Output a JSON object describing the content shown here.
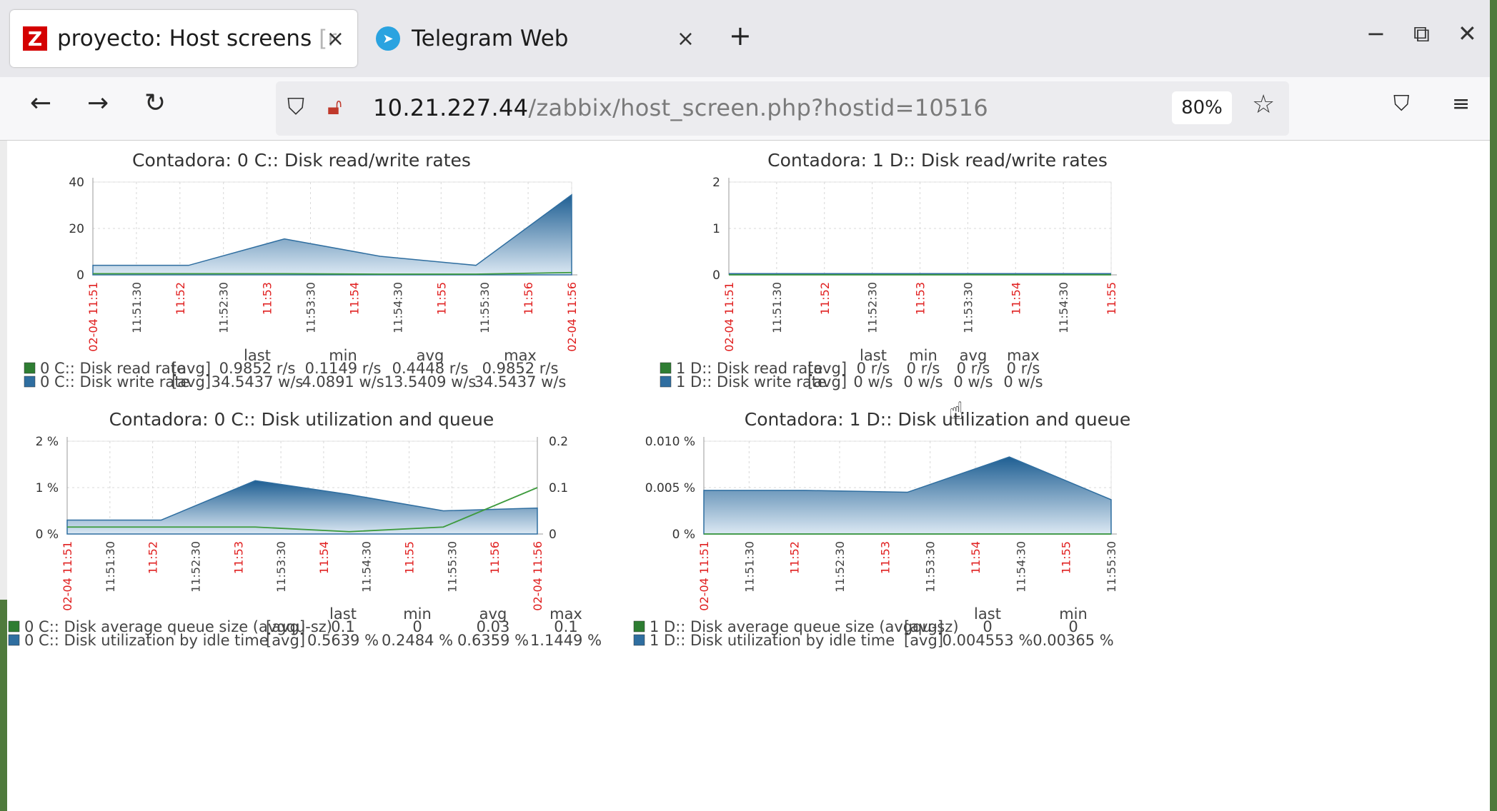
{
  "browser": {
    "tabs": [
      {
        "favicon": "Z",
        "title": "proyecto: Host screens",
        "title_fade": "[r",
        "close": "×"
      },
      {
        "favicon": "telegram-icon",
        "title": "Telegram Web",
        "close": "×"
      }
    ],
    "new_tab": "+",
    "window_controls": {
      "minimize": "−",
      "restore": "⧉",
      "close": "✕"
    },
    "nav": {
      "back": "←",
      "forward": "→",
      "reload": "↻"
    },
    "url_host": "10.21.227.44",
    "url_path": "/zabbix/host_screen.php?hostid=10516",
    "zoom": "80%"
  },
  "legend_headers": {
    "last": "last",
    "min": "min",
    "avg": "avg",
    "max": "max"
  },
  "colors": {
    "green": "#2e7d32",
    "blue": "#2f6ea0",
    "red_tick": "#e02020"
  },
  "charts": [
    {
      "title": "Contadora: 0 C:: Disk read/write rates",
      "yticks": [
        "40",
        "20",
        "0"
      ],
      "legend": [
        {
          "name": "0 C:: Disk read rate",
          "func": "[avg]",
          "last": "0.9852 r/s",
          "min": "0.1149 r/s",
          "avg": "0.4448 r/s",
          "max": "0.9852 r/s"
        },
        {
          "name": "0 C:: Disk write rate",
          "func": "[avg]",
          "last": "34.5437 w/s",
          "min": "4.0891 w/s",
          "avg": "13.5409 w/s",
          "max": "34.5437 w/s"
        }
      ]
    },
    {
      "title": "Contadora: 1 D:: Disk read/write rates",
      "yticks": [
        "2",
        "1",
        "0"
      ],
      "legend": [
        {
          "name": "1 D:: Disk read rate",
          "func": "[avg]",
          "last": "0 r/s",
          "min": "0 r/s",
          "avg": "0 r/s",
          "max": "0 r/s"
        },
        {
          "name": "1 D:: Disk write rate",
          "func": "[avg]",
          "last": "0 w/s",
          "min": "0 w/s",
          "avg": "0 w/s",
          "max": "0 w/s"
        }
      ]
    },
    {
      "title": "Contadora: 0 C:: Disk utilization and queue",
      "yticks": [
        "2 %",
        "1 %",
        "0 %"
      ],
      "yticks_right": [
        "0.2",
        "0.1",
        "0"
      ],
      "legend": [
        {
          "name": "0 C:: Disk average queue size (avgqu-sz)",
          "func": "[avg]",
          "last": "0.1",
          "min": "0",
          "avg": "0.03",
          "max": "0.1"
        },
        {
          "name": "0 C:: Disk utilization by idle time",
          "func": "[avg]",
          "last": "0.5639 %",
          "min": "0.2484 %",
          "avg": "0.6359 %",
          "max": "1.1449 %"
        }
      ]
    },
    {
      "title": "Contadora: 1 D:: Disk utilization and queue",
      "yticks": [
        "0.010 %",
        "0.005 %",
        "0 %"
      ],
      "legend": [
        {
          "name": "1 D:: Disk average queue size (avgqu-sz)",
          "func": "[avg]",
          "last": "0",
          "min": "0"
        },
        {
          "name": "1 D:: Disk utilization by idle time",
          "func": "[avg]",
          "last": "0.004553 %",
          "min": "0.00365 %"
        }
      ]
    }
  ],
  "chart_data": [
    {
      "type": "area",
      "title": "Contadora: 0 C:: Disk read/write rates",
      "x": [
        "11:51",
        "11:52",
        "11:53",
        "11:54",
        "11:55",
        "11:56"
      ],
      "x_labels": [
        "02-04 11:51",
        "11:51:30",
        "11:52",
        "11:52:30",
        "11:53",
        "11:53:30",
        "11:54",
        "11:54:30",
        "11:55",
        "11:55:30",
        "11:56",
        "02-04 11:56"
      ],
      "ylim": [
        0,
        40
      ],
      "series": [
        {
          "name": "0 C:: Disk read rate",
          "values": [
            0.5,
            0.5,
            0.5,
            0.3,
            0.3,
            1.0
          ]
        },
        {
          "name": "0 C:: Disk write rate",
          "values": [
            4.1,
            4.1,
            15.5,
            8,
            4.1,
            34.5
          ]
        }
      ]
    },
    {
      "type": "line",
      "title": "Contadora: 1 D:: Disk read/write rates",
      "x": [
        "11:51",
        "11:52",
        "11:53",
        "11:54",
        "11:55"
      ],
      "x_labels": [
        "02-04 11:51",
        "11:51:30",
        "11:52",
        "11:52:30",
        "11:53",
        "11:53:30",
        "11:54",
        "11:54:30",
        "11:55"
      ],
      "ylim": [
        0,
        2
      ],
      "series": [
        {
          "name": "1 D:: Disk read rate",
          "values": [
            0,
            0,
            0,
            0,
            0
          ]
        },
        {
          "name": "1 D:: Disk write rate",
          "values": [
            0,
            0,
            0,
            0,
            0
          ]
        }
      ]
    },
    {
      "type": "area",
      "title": "Contadora: 0 C:: Disk utilization and queue",
      "x": [
        "11:51",
        "11:52",
        "11:53",
        "11:54",
        "11:55",
        "11:56"
      ],
      "x_labels": [
        "02-04 11:51",
        "11:51:30",
        "11:52",
        "11:52:30",
        "11:53",
        "11:53:30",
        "11:54",
        "11:54:30",
        "11:55",
        "11:55:30",
        "11:56",
        "02-04 11:56"
      ],
      "ylim": [
        0,
        2
      ],
      "ylim_right": [
        0,
        0.2
      ],
      "series": [
        {
          "name": "0 C:: Disk average queue size (avgqu-sz)",
          "values": [
            0.015,
            0.015,
            0.015,
            0.005,
            0.015,
            0.1
          ]
        },
        {
          "name": "0 C:: Disk utilization by idle time",
          "values": [
            0.3,
            0.3,
            1.15,
            0.85,
            0.5,
            0.56
          ]
        }
      ]
    },
    {
      "type": "area",
      "title": "Contadora: 1 D:: Disk utilization and queue",
      "x": [
        "11:51",
        "11:52",
        "11:53",
        "11:54",
        "11:55"
      ],
      "x_labels": [
        "02-04 11:51",
        "11:51:30",
        "11:52",
        "11:52:30",
        "11:53",
        "11:53:30",
        "11:54",
        "11:54:30",
        "11:55",
        "11:55:30"
      ],
      "ylim": [
        0,
        0.01
      ],
      "series": [
        {
          "name": "1 D:: Disk average queue size (avgqu-sz)",
          "values": [
            0,
            0,
            0,
            0,
            0
          ]
        },
        {
          "name": "1 D:: Disk utilization by idle time",
          "values": [
            0.0047,
            0.0047,
            0.0045,
            0.0083,
            0.0037
          ]
        }
      ]
    }
  ]
}
